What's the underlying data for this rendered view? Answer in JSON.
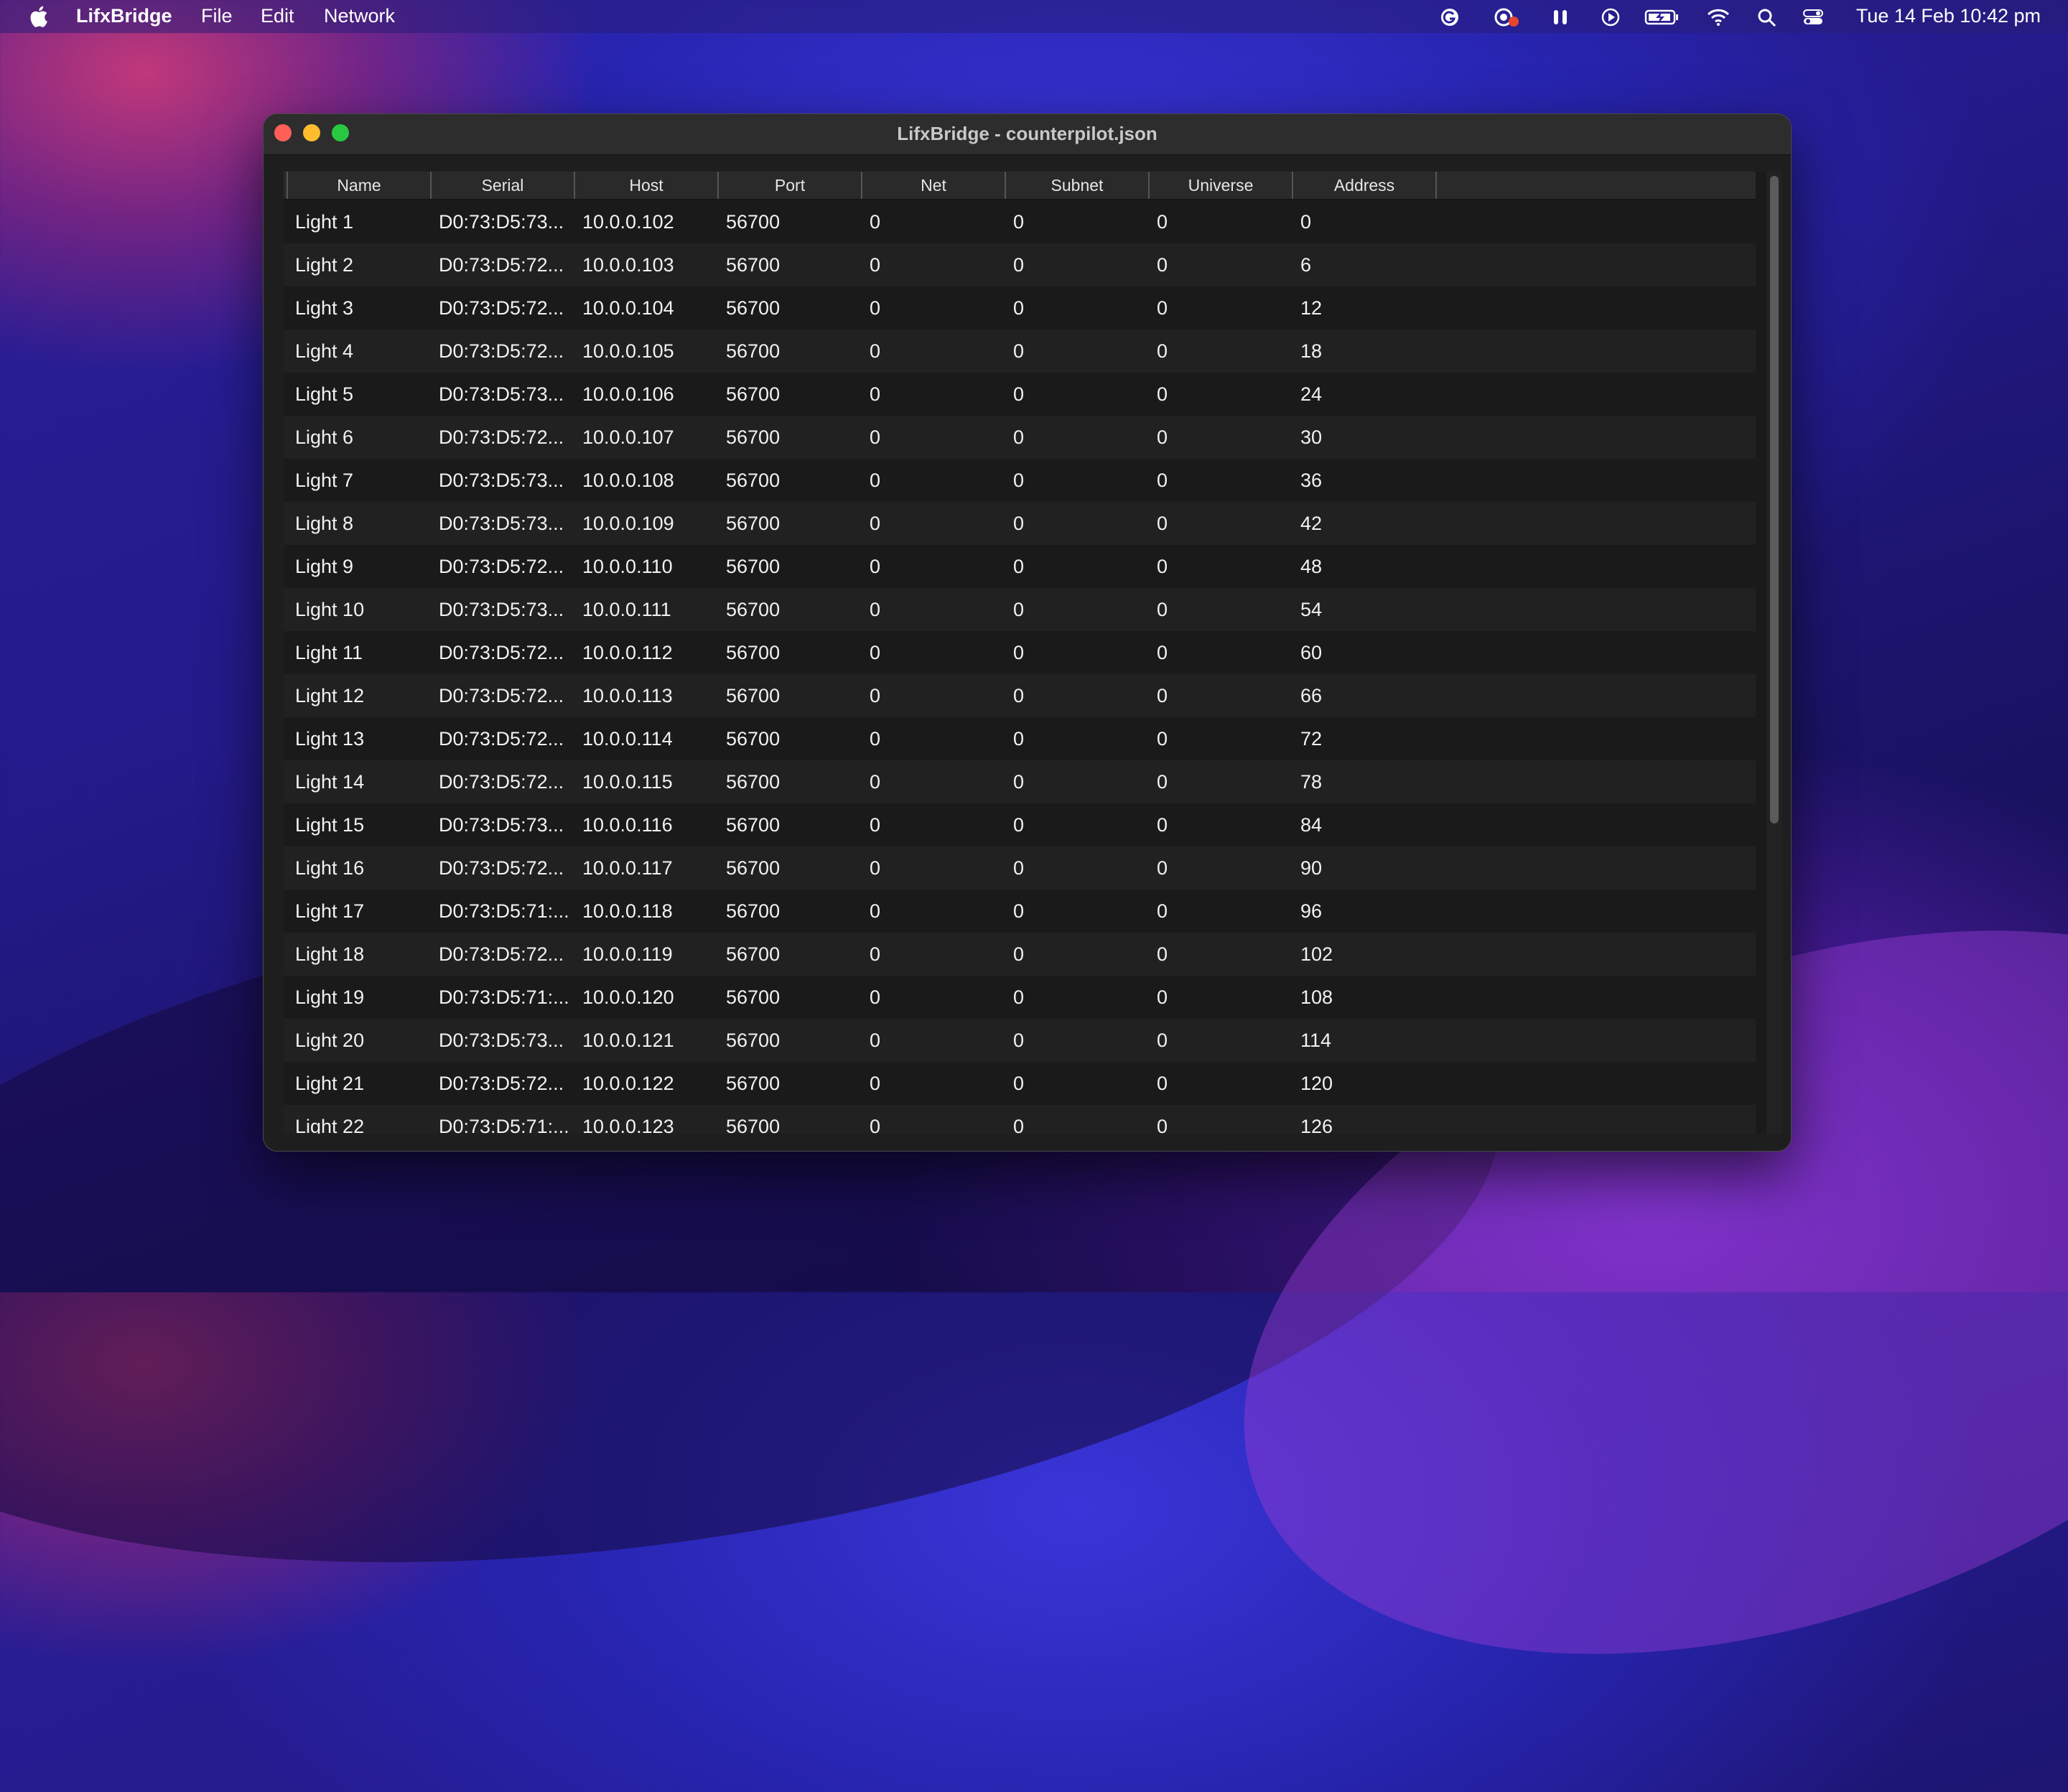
{
  "menubar": {
    "app_name": "LifxBridge",
    "menus": [
      "File",
      "Edit",
      "Network"
    ],
    "status_icons": [
      "grammarly-icon",
      "screen-share-icon",
      "airpods-icon",
      "play-icon",
      "battery-charging-icon",
      "wifi-icon",
      "search-icon",
      "control-center-icon"
    ],
    "clock": "Tue 14 Feb  10:42 pm"
  },
  "window": {
    "title": "LifxBridge - counterpilot.json"
  },
  "table": {
    "columns": [
      "Name",
      "Serial",
      "Host",
      "Port",
      "Net",
      "Subnet",
      "Universe",
      "Address"
    ],
    "rows": [
      [
        "Light 1",
        "D0:73:D5:73...",
        "10.0.0.102",
        "56700",
        "0",
        "0",
        "0",
        "0"
      ],
      [
        "Light 2",
        "D0:73:D5:72...",
        "10.0.0.103",
        "56700",
        "0",
        "0",
        "0",
        "6"
      ],
      [
        "Light 3",
        "D0:73:D5:72...",
        "10.0.0.104",
        "56700",
        "0",
        "0",
        "0",
        "12"
      ],
      [
        "Light 4",
        "D0:73:D5:72...",
        "10.0.0.105",
        "56700",
        "0",
        "0",
        "0",
        "18"
      ],
      [
        "Light 5",
        "D0:73:D5:73...",
        "10.0.0.106",
        "56700",
        "0",
        "0",
        "0",
        "24"
      ],
      [
        "Light 6",
        "D0:73:D5:72...",
        "10.0.0.107",
        "56700",
        "0",
        "0",
        "0",
        "30"
      ],
      [
        "Light 7",
        "D0:73:D5:73...",
        "10.0.0.108",
        "56700",
        "0",
        "0",
        "0",
        "36"
      ],
      [
        "Light 8",
        "D0:73:D5:73...",
        "10.0.0.109",
        "56700",
        "0",
        "0",
        "0",
        "42"
      ],
      [
        "Light 9",
        "D0:73:D5:72...",
        "10.0.0.110",
        "56700",
        "0",
        "0",
        "0",
        "48"
      ],
      [
        "Light 10",
        "D0:73:D5:73...",
        "10.0.0.111",
        "56700",
        "0",
        "0",
        "0",
        "54"
      ],
      [
        "Light 11",
        "D0:73:D5:72...",
        "10.0.0.112",
        "56700",
        "0",
        "0",
        "0",
        "60"
      ],
      [
        "Light 12",
        "D0:73:D5:72...",
        "10.0.0.113",
        "56700",
        "0",
        "0",
        "0",
        "66"
      ],
      [
        "Light 13",
        "D0:73:D5:72...",
        "10.0.0.114",
        "56700",
        "0",
        "0",
        "0",
        "72"
      ],
      [
        "Light 14",
        "D0:73:D5:72...",
        "10.0.0.115",
        "56700",
        "0",
        "0",
        "0",
        "78"
      ],
      [
        "Light 15",
        "D0:73:D5:73...",
        "10.0.0.116",
        "56700",
        "0",
        "0",
        "0",
        "84"
      ],
      [
        "Light 16",
        "D0:73:D5:72...",
        "10.0.0.117",
        "56700",
        "0",
        "0",
        "0",
        "90"
      ],
      [
        "Light 17",
        "D0:73:D5:71:...",
        "10.0.0.118",
        "56700",
        "0",
        "0",
        "0",
        "96"
      ],
      [
        "Light 18",
        "D0:73:D5:72...",
        "10.0.0.119",
        "56700",
        "0",
        "0",
        "0",
        "102"
      ],
      [
        "Light 19",
        "D0:73:D5:71:...",
        "10.0.0.120",
        "56700",
        "0",
        "0",
        "0",
        "108"
      ],
      [
        "Light 20",
        "D0:73:D5:73...",
        "10.0.0.121",
        "56700",
        "0",
        "0",
        "0",
        "114"
      ],
      [
        "Light 21",
        "D0:73:D5:72...",
        "10.0.0.122",
        "56700",
        "0",
        "0",
        "0",
        "120"
      ],
      [
        "Light 22",
        "D0:73:D5:71:...",
        "10.0.0.123",
        "56700",
        "0",
        "0",
        "0",
        "126"
      ]
    ]
  },
  "colors": {
    "window_bg": "#1e1e1e",
    "titlebar": "#2d2d2d",
    "close": "#ff5f57",
    "minimize": "#febc2e",
    "maximize": "#28c840"
  }
}
